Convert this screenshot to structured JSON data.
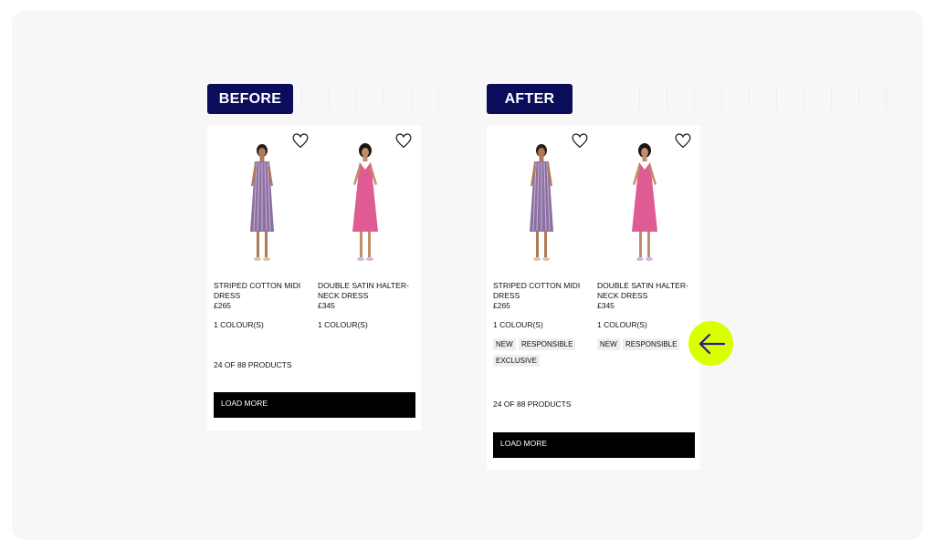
{
  "panels": {
    "before": {
      "label": "BEFORE",
      "products": [
        {
          "name": "STRIPED COTTON MIDI DRESS",
          "price": "£265",
          "colours": "1 COLOUR(S)",
          "tags": []
        },
        {
          "name": "DOUBLE SATIN HALTER-NECK DRESS",
          "price": "£345",
          "colours": "1 COLOUR(S)",
          "tags": []
        }
      ],
      "count": "24 OF 88 PRODUCTS",
      "load_more": "LOAD MORE"
    },
    "after": {
      "label": "AFTER",
      "products": [
        {
          "name": "STRIPED COTTON MIDI DRESS",
          "price": "£265",
          "colours": "1 COLOUR(S)",
          "tags": [
            "NEW",
            "RESPONSIBLE",
            "EXCLUSIVE"
          ]
        },
        {
          "name": "DOUBLE SATIN HALTER-NECK DRESS",
          "price": "£345",
          "colours": "1 COLOUR(S)",
          "tags": [
            "NEW",
            "RESPONSIBLE"
          ]
        }
      ],
      "count": "24 OF 88 PRODUCTS",
      "load_more": "LOAD MORE"
    }
  },
  "icons": {
    "wishlist": "heart-icon",
    "callout": "arrow-left-icon"
  },
  "colors": {
    "label_bg": "#0b0c5a",
    "callout_bg": "#d9ff00",
    "callout_arrow": "#2a1a8c",
    "stripe_dress": "#8a6fa0",
    "pink_dress": "#e05a93",
    "tag_bg": "#efefef"
  }
}
